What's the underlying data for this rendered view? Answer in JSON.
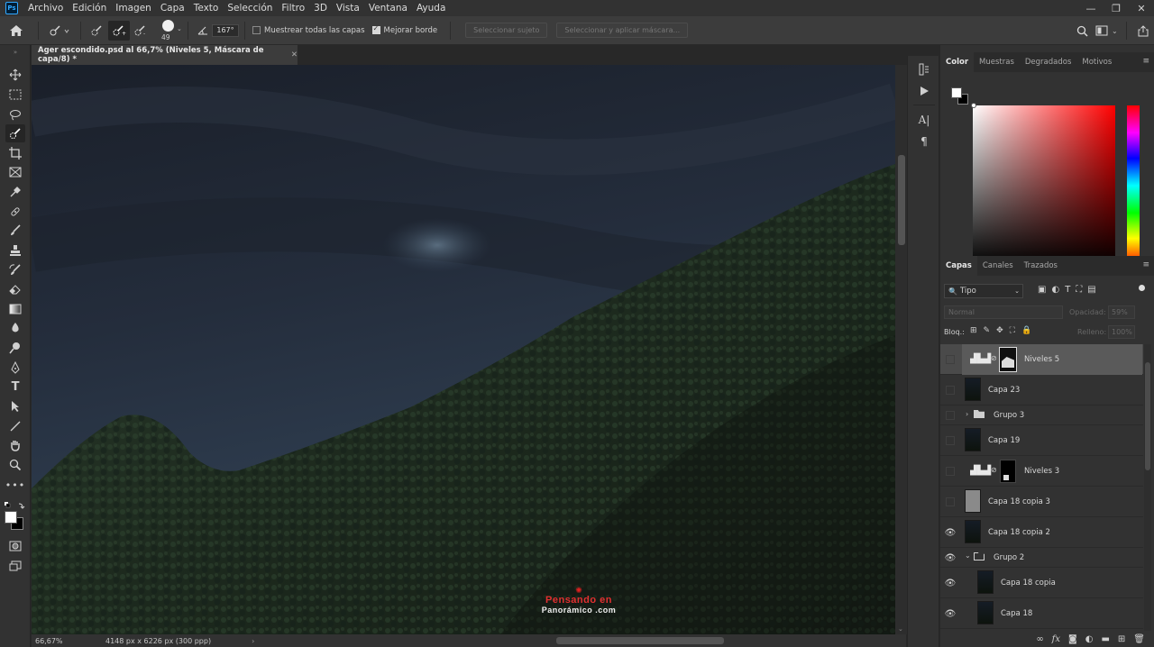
{
  "app": {
    "logo": "Ps"
  },
  "menu": [
    "Archivo",
    "Edición",
    "Imagen",
    "Capa",
    "Texto",
    "Selección",
    "Filtro",
    "3D",
    "Vista",
    "Ventana",
    "Ayuda"
  ],
  "window_controls": {
    "minimize": "—",
    "restore": "❐",
    "close": "✕"
  },
  "options": {
    "brush_size": "49",
    "angle": "167°",
    "sample_all_layers": "Muestrear todas las capas",
    "improve_edge": "Mejorar borde",
    "select_subject": "Seleccionar sujeto",
    "select_and_mask": "Seleccionar y aplicar máscara..."
  },
  "document": {
    "tab_title": "Ager escondido.psd al 66,7% (Niveles 5, Máscara de capa/8) *",
    "close": "✕",
    "watermark_line1": "Pensando en",
    "watermark_line2": "Panorámico .com"
  },
  "status": {
    "zoom": "66,67%",
    "size": "4148 px x 6226 px (300 ppp)",
    "arrow": "›"
  },
  "color_panel": {
    "tabs": [
      "Color",
      "Muestras",
      "Degradados",
      "Motivos"
    ],
    "foreground": "#ffffff",
    "background": "#000000"
  },
  "layers_panel": {
    "tabs": [
      "Capas",
      "Canales",
      "Trazados"
    ],
    "filter": "Tipo",
    "blend_mode": "Normal",
    "opacity_label": "Opacidad:",
    "opacity_value": "59%",
    "lock_label": "Bloq.:",
    "fill_label": "Relleno:",
    "fill_value": "100%",
    "layers": [
      {
        "name": "Niveles 5",
        "type": "adjustment",
        "visible": false,
        "selected": true
      },
      {
        "name": "Capa 23",
        "type": "pixel",
        "visible": false
      },
      {
        "name": "Grupo 3",
        "type": "group",
        "visible": false
      },
      {
        "name": "Capa 19",
        "type": "pixel",
        "visible": false
      },
      {
        "name": "Niveles 3",
        "type": "adjustment",
        "visible": false
      },
      {
        "name": "Capa 18 copia 3",
        "type": "pixel-gray",
        "visible": false
      },
      {
        "name": "Capa 18 copia 2",
        "type": "pixel",
        "visible": true
      },
      {
        "name": "Grupo 2",
        "type": "group-open",
        "visible": true
      },
      {
        "name": "Capa 18 copia",
        "type": "pixel",
        "visible": true,
        "indent": true
      },
      {
        "name": "Capa 18",
        "type": "pixel",
        "visible": true,
        "indent": true
      }
    ],
    "footer_icons": [
      "link-icon",
      "fx-icon",
      "mask-icon",
      "adjustment-icon",
      "folder-icon",
      "new-layer-icon",
      "trash-icon"
    ]
  }
}
